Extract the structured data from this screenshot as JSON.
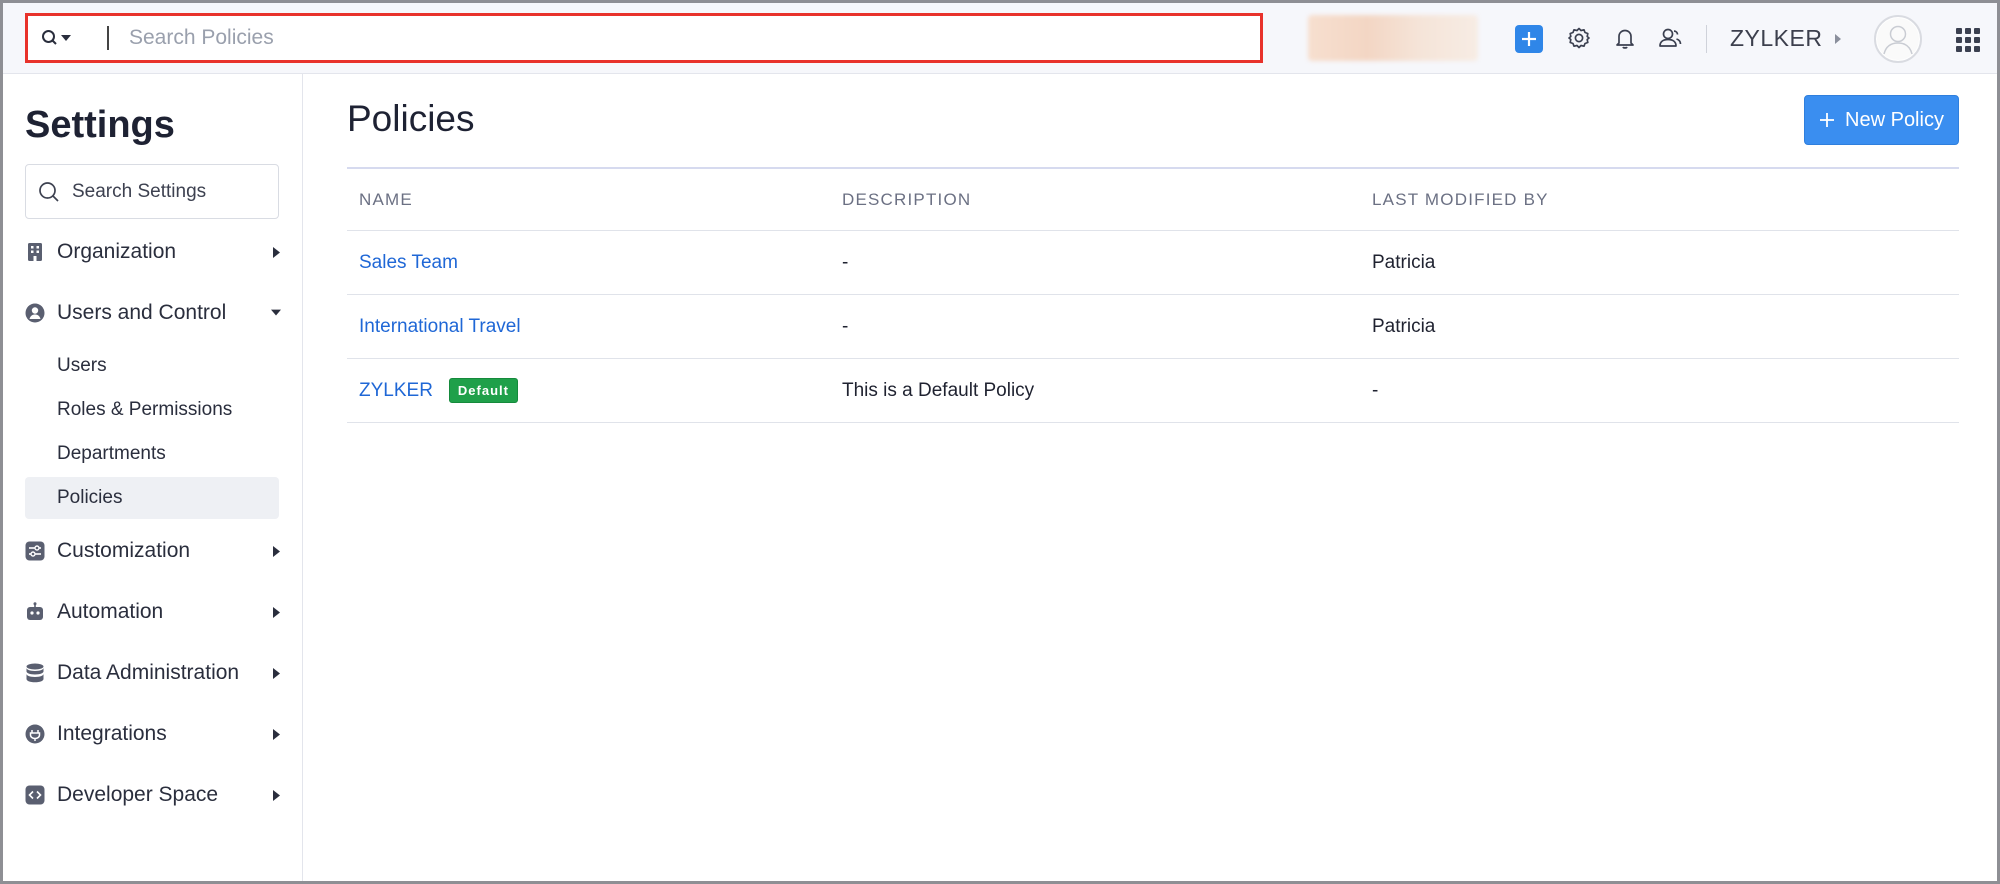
{
  "topbar": {
    "search_placeholder": "Search Policies",
    "org_name": "ZYLKER"
  },
  "sidebar": {
    "title": "Settings",
    "search_placeholder": "Search Settings",
    "items": [
      {
        "label": "Organization",
        "icon": "building-icon"
      },
      {
        "label": "Users and Control",
        "icon": "user-circle-icon"
      },
      {
        "label": "Customization",
        "icon": "sliders-icon"
      },
      {
        "label": "Automation",
        "icon": "robot-icon"
      },
      {
        "label": "Data Administration",
        "icon": "database-icon"
      },
      {
        "label": "Integrations",
        "icon": "plug-icon"
      },
      {
        "label": "Developer Space",
        "icon": "code-icon"
      }
    ],
    "sub_items": [
      "Users",
      "Roles & Permissions",
      "Departments",
      "Policies"
    ]
  },
  "main": {
    "title": "Policies",
    "new_button": "New Policy",
    "columns": [
      "NAME",
      "DESCRIPTION",
      "LAST MODIFIED BY"
    ],
    "rows": [
      {
        "name": "Sales Team",
        "description": "-",
        "modified_by": "Patricia",
        "badge": ""
      },
      {
        "name": "International Travel",
        "description": "-",
        "modified_by": "Patricia",
        "badge": ""
      },
      {
        "name": "ZYLKER",
        "description": "This is a Default Policy",
        "modified_by": "-",
        "badge": "Default"
      }
    ]
  },
  "colors": {
    "accent": "#3a8ef0",
    "link": "#1f67d6",
    "badge": "#1fa04a",
    "highlight_border": "#e8322b"
  }
}
